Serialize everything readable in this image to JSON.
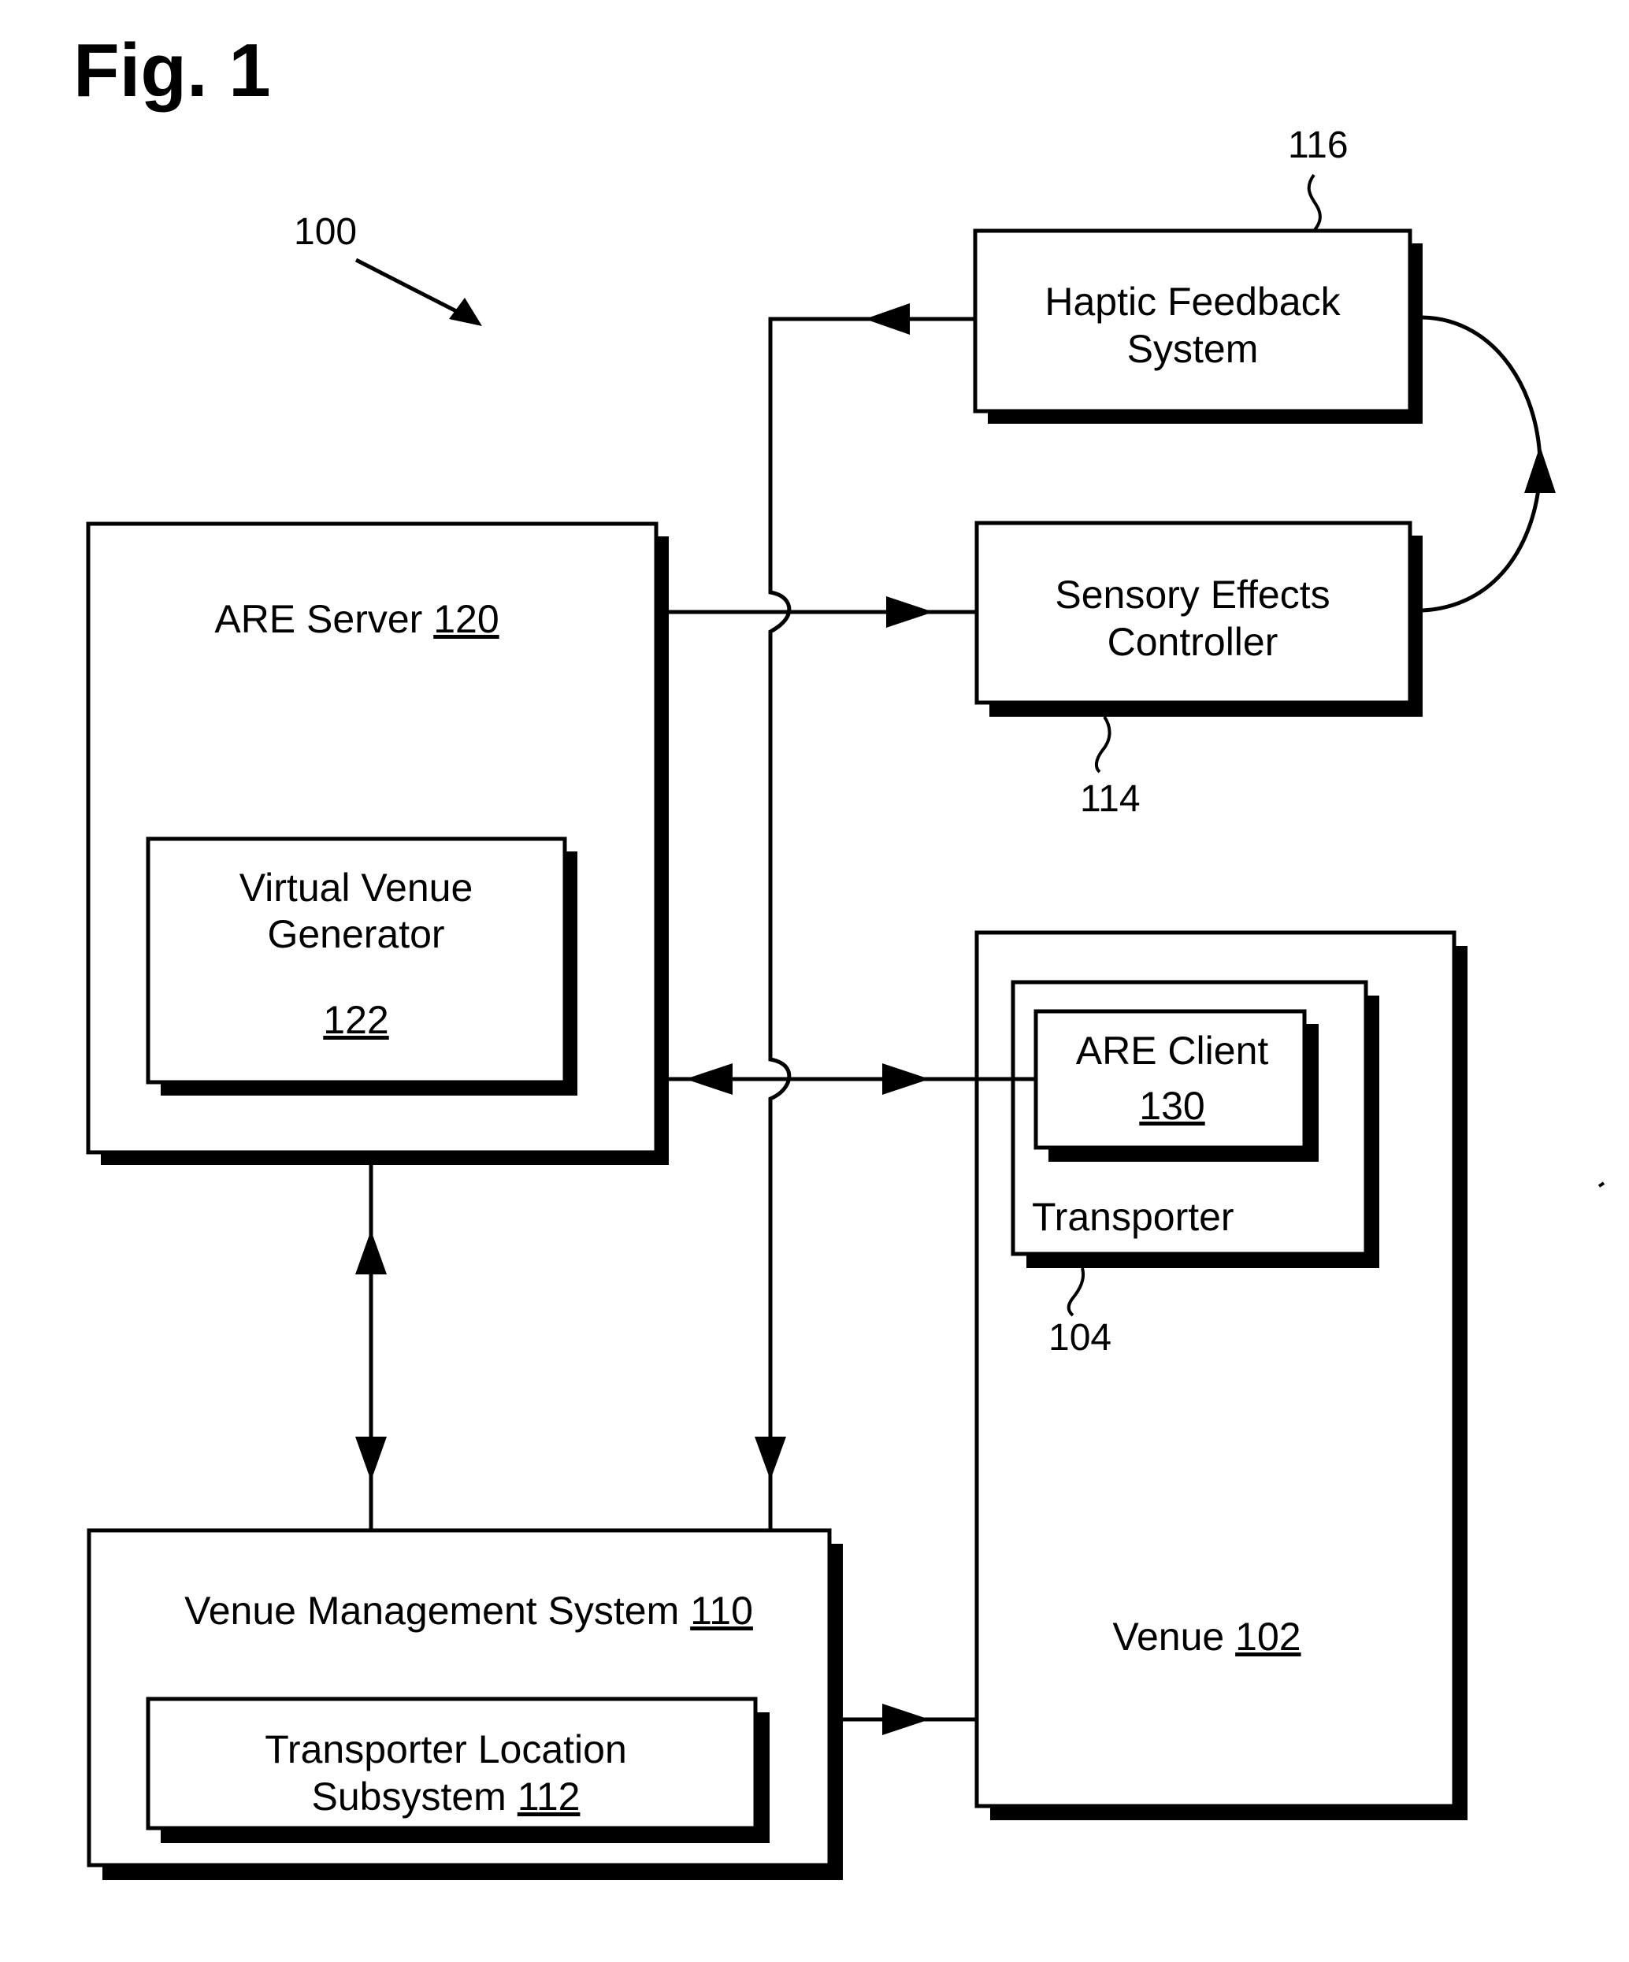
{
  "figure": {
    "title": "Fig. 1",
    "system_ref": "100"
  },
  "blocks": {
    "haptic": {
      "line1": "Haptic Feedback",
      "line2": "System",
      "ref": "116"
    },
    "sensory": {
      "line1": "Sensory Effects",
      "line2": "Controller",
      "ref": "114"
    },
    "are_server": {
      "name": "ARE Server",
      "num": "120"
    },
    "virtual_venue_generator": {
      "line1": "Virtual Venue",
      "line2": "Generator",
      "num": "122"
    },
    "venue": {
      "name": "Venue",
      "num": "102"
    },
    "transporter": {
      "name": "Transporter",
      "ref": "104"
    },
    "are_client": {
      "name": "ARE Client",
      "num": "130"
    },
    "venue_management": {
      "name": "Venue Management System",
      "num": "110"
    },
    "transporter_location": {
      "line1": "Transporter Location",
      "line2": "Subsystem",
      "num": "112"
    }
  },
  "connections": [
    {
      "from": "ARE Server",
      "to": "Sensory Effects Controller",
      "direction": "one-way"
    },
    {
      "from": "Sensory Effects Controller",
      "to": "Haptic Feedback System",
      "direction": "one-way"
    },
    {
      "from": "Haptic Feedback System",
      "to": "Venue Management System",
      "direction": "one-way"
    },
    {
      "from": "ARE Server",
      "to": "ARE Client",
      "direction": "two-way"
    },
    {
      "from": "ARE Server",
      "to": "Venue Management System",
      "direction": "two-way"
    },
    {
      "from": "Venue Management System",
      "to": "Venue",
      "direction": "one-way"
    }
  ]
}
